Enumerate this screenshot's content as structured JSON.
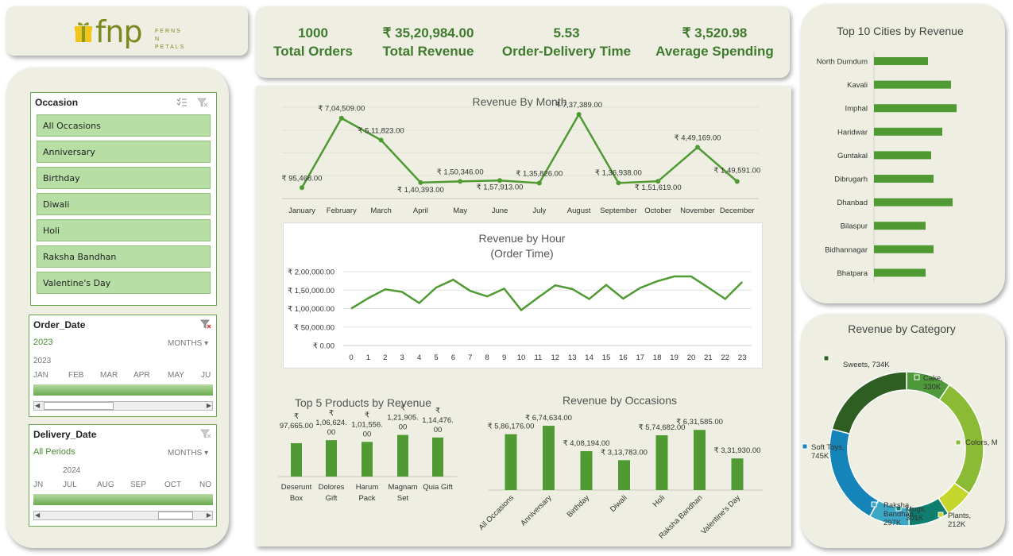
{
  "logo": {
    "brand": "fnp",
    "sub_line1": "FERNS",
    "sub_line2": "N",
    "sub_line3": "PETALS"
  },
  "kpis": [
    {
      "value": "1000",
      "label": "Total Orders"
    },
    {
      "value": "₹ 35,20,984.00",
      "label": "Total Revenue"
    },
    {
      "value": "5.53",
      "label": "Order-Delivery Time"
    },
    {
      "value": "₹ 3,520.98",
      "label": "Average Spending"
    }
  ],
  "occasion_slicer": {
    "title": "Occasion",
    "items": [
      "All Occasions",
      "Anniversary",
      "Birthday",
      "Diwali",
      "Holi",
      "Raksha Bandhan",
      "Valentine's Day"
    ]
  },
  "order_date": {
    "title": "Order_Date",
    "selection": "2023",
    "unit": "MONTHS",
    "year": "2023",
    "months": [
      "JAN",
      "FEB",
      "MAR",
      "APR",
      "MAY",
      "JU"
    ]
  },
  "delivery_date": {
    "title": "Delivery_Date",
    "selection": "All Periods",
    "unit": "MONTHS",
    "year": "2024",
    "months": [
      "JN",
      "JUL",
      "AUG",
      "SEP",
      "OCT",
      "NO"
    ]
  },
  "colors": {
    "accent": "#4f9a33",
    "card": "#eeeee2",
    "kpi_text": "#3f7a2e"
  },
  "chart_data": [
    {
      "id": "revenue_by_month",
      "type": "line",
      "title": "Revenue By Month",
      "categories": [
        "January",
        "February",
        "March",
        "April",
        "May",
        "June",
        "July",
        "August",
        "September",
        "October",
        "November",
        "December"
      ],
      "values": [
        95468,
        704509,
        511823,
        140393,
        150346,
        157913,
        135826,
        737389,
        136938,
        151619,
        449169,
        149591
      ],
      "labels": [
        "₹ 95,468.00",
        "₹ 7,04,509.00",
        "₹ 5,11,823.00",
        "₹ 1,40,393.00",
        "₹ 1,50,346.00",
        "₹ 1,57,913.00",
        "₹ 1,35,826.00",
        "₹ 7,37,389.00",
        "₹ 1,36,938.00",
        "₹ 1,51,619.00",
        "₹ 4,49,169.00",
        "₹ 1,49,591.00"
      ],
      "ylim": [
        0,
        800000
      ],
      "grid": true
    },
    {
      "id": "revenue_by_hour",
      "type": "line",
      "title_line1": "Revenue by Hour",
      "title_line2": "(Order Time)",
      "categories": [
        "0",
        "1",
        "2",
        "3",
        "4",
        "5",
        "6",
        "7",
        "8",
        "9",
        "10",
        "11",
        "12",
        "13",
        "14",
        "15",
        "16",
        "17",
        "18",
        "19",
        "20",
        "21",
        "22",
        "23"
      ],
      "values": [
        100000,
        128000,
        152000,
        145000,
        115000,
        157000,
        178000,
        148000,
        133000,
        154000,
        96000,
        130000,
        163000,
        153000,
        126000,
        164000,
        127000,
        156000,
        174000,
        187000,
        187000,
        157000,
        126000,
        172000
      ],
      "yticks": [
        "₹ 0.00",
        "₹ 50,000.00",
        "₹ 1,00,000.00",
        "₹ 1,50,000.00",
        "₹ 2,00,000.00"
      ],
      "ylim": [
        0,
        200000
      ],
      "grid": true
    },
    {
      "id": "top5_products",
      "type": "bar",
      "title": "Top 5 Products by Revenue",
      "categories_line1": [
        "Deserunt",
        "Dolores",
        "Harum",
        "Magnam",
        "Quia Gift"
      ],
      "categories_line2": [
        "Box",
        "Gift",
        "Pack",
        "Set",
        ""
      ],
      "values": [
        97665,
        106624,
        101556,
        121905,
        114476
      ],
      "labels_line1": [
        "₹",
        "₹",
        "₹",
        "₹",
        "₹"
      ],
      "labels_line2": [
        "97,665.00",
        "1,06,624.",
        "1,01,556.",
        "1,21,905.",
        "1,14,476."
      ],
      "labels_line3": [
        "",
        "00",
        "00",
        "00",
        "00"
      ]
    },
    {
      "id": "revenue_by_occasions",
      "type": "bar",
      "title": "Revenue by Occasions",
      "categories": [
        "All Occasions",
        "Anniversary",
        "Birthday",
        "Diwali",
        "Holi",
        "Raksha Bandhan",
        "Valentine's Day"
      ],
      "values": [
        586176,
        674634,
        408194,
        313783,
        574682,
        631585,
        331930
      ],
      "labels": [
        "₹ 5,86,176.00",
        "₹ 6,74,634.00",
        "₹ 4,08,194.00",
        "₹ 3,13,783.00",
        "₹ 5,74,682.00",
        "₹ 6,31,585.00",
        "₹ 3,31,930.00"
      ]
    },
    {
      "id": "top10_cities",
      "type": "bar",
      "orientation": "horizontal",
      "title": "Top 10 Cities by Revenue",
      "categories": [
        "North Dumdum",
        "Kavali",
        "Imphal",
        "Haridwar",
        "Guntakal",
        "Dibrugarh",
        "Dhanbad",
        "Bilaspur",
        "Bidhannagar",
        "Bhatpara"
      ],
      "values": [
        68,
        97,
        104,
        86,
        72,
        75,
        99,
        65,
        75,
        65
      ]
    },
    {
      "id": "revenue_by_category",
      "type": "pie",
      "donut": true,
      "title": "Revenue by Category",
      "categories": [
        "Cake",
        "Colors",
        "Plants",
        "Mugs",
        "Raksha Bandhan",
        "Soft Toys",
        "Sweets"
      ],
      "values": [
        330,
        895,
        212,
        301,
        297,
        745,
        734
      ],
      "colors": [
        "#4e9a3a",
        "#8bbb34",
        "#c5d62c",
        "#0e7f6f",
        "#3aa7c4",
        "#1584b8",
        "#2e5e22"
      ],
      "labels_line1": [
        "Cake,",
        "Colors, M",
        "Plants,",
        "Mugs,",
        "Raksha",
        "Soft Toys,",
        "Sweets, 734K"
      ],
      "labels_line2": [
        "330K",
        "",
        "212K",
        "301K",
        "Bandhan,",
        "745K",
        ""
      ],
      "labels_line3": [
        "",
        "",
        "",
        "",
        "297K",
        "",
        ""
      ]
    }
  ]
}
